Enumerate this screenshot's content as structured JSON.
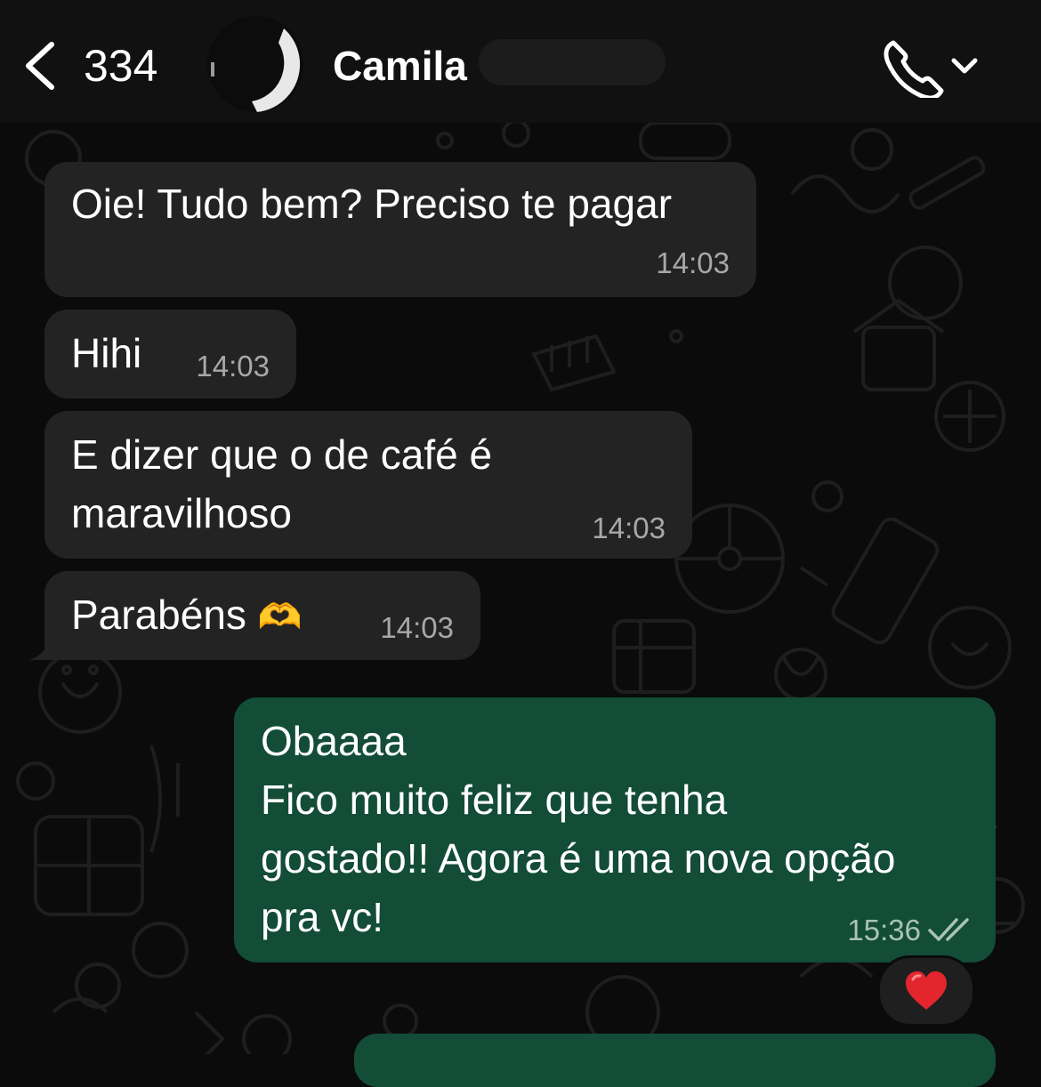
{
  "header": {
    "back_count": "334",
    "contact_name": "Camila",
    "icons": {
      "back": "chevron-left-icon",
      "call": "phone-icon",
      "call_menu": "chevron-down-icon"
    }
  },
  "messages": [
    {
      "direction": "incoming",
      "text": "Oie! Tudo bem? Preciso te pagar",
      "time": "14:03"
    },
    {
      "direction": "incoming",
      "text": "Hihi",
      "time": "14:03"
    },
    {
      "direction": "incoming",
      "text": "E dizer que o de café é\nmaravilhoso",
      "time": "14:03"
    },
    {
      "direction": "incoming",
      "text": "Parabéns",
      "emoji": "🫶",
      "time": "14:03"
    },
    {
      "direction": "outgoing",
      "text": "Obaaaa\nFico muito feliz que tenha\ngostado!! Agora é uma nova opção\npra vc!",
      "time": "15:36",
      "status": "read-double-check"
    }
  ],
  "reaction": {
    "emoji": "❤️"
  },
  "colors": {
    "incoming_bubble": "#232323",
    "outgoing_bubble": "#134c37",
    "background": "#0b0b0b",
    "header": "#111111"
  }
}
